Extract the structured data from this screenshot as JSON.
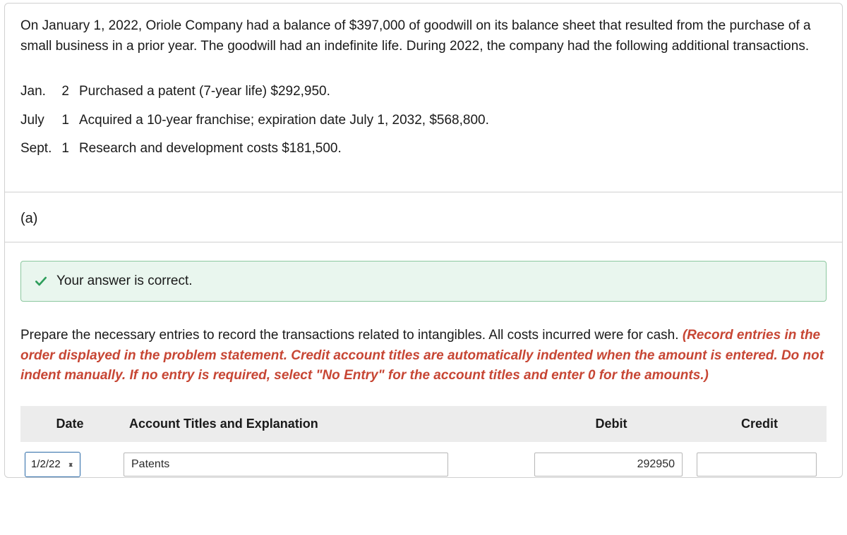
{
  "problem": {
    "intro": "On January 1, 2022, Oriole Company had a balance of $397,000 of goodwill on its balance sheet that resulted from the purchase of a small business in a prior year. The goodwill had an indefinite life. During 2022, the company had the following additional transactions.",
    "transactions": [
      {
        "month": "Jan.",
        "day": "2",
        "desc": "Purchased a patent (7-year life) $292,950."
      },
      {
        "month": "July",
        "day": "1",
        "desc": "Acquired a 10-year franchise; expiration date July 1, 2032, $568,800."
      },
      {
        "month": "Sept.",
        "day": "1",
        "desc": "Research and development costs $181,500."
      }
    ]
  },
  "part_label": "(a)",
  "banner": {
    "text": "Your answer is correct."
  },
  "instructions": {
    "lead": "Prepare the necessary entries to record the transactions related to intangibles. All costs incurred were for cash. ",
    "emph": "(Record entries in the order displayed in the problem statement. Credit account titles are automatically indented when the amount is entered. Do not indent manually. If no entry is required, select \"No Entry\" for the account titles and enter 0 for the amounts.)"
  },
  "journal": {
    "headers": {
      "date": "Date",
      "acct": "Account Titles and Explanation",
      "debit": "Debit",
      "credit": "Credit"
    },
    "rows": [
      {
        "date": "1/2/22",
        "acct": "Patents",
        "debit": "292950",
        "credit": ""
      }
    ]
  }
}
